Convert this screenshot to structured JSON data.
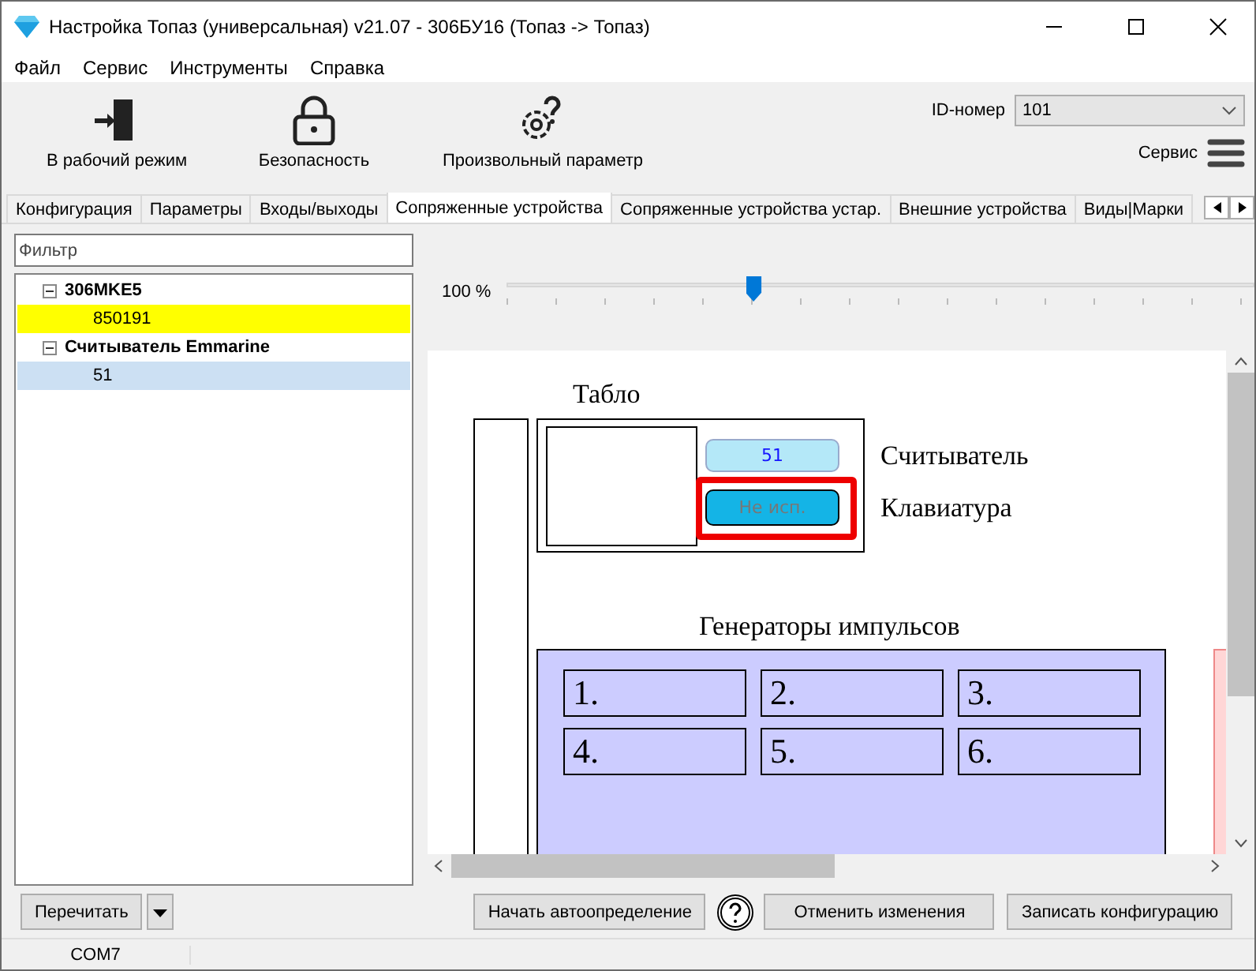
{
  "window": {
    "title": "Настройка Топаз (универсальная) v21.07 - 306БУ16 (Топаз -> Топаз)"
  },
  "menu": [
    "Файл",
    "Сервис",
    "Инструменты",
    "Справка"
  ],
  "toolbar": {
    "tools": [
      {
        "label": "В рабочий режим",
        "kind": "exit"
      },
      {
        "label": "Безопасность",
        "kind": "lock"
      },
      {
        "label": "Произвольный параметр",
        "kind": "gear"
      }
    ],
    "id_label": "ID-номер",
    "id_value": "101",
    "service_label": "Сервис"
  },
  "tabs": [
    {
      "label": "Конфигурация",
      "selected": false
    },
    {
      "label": "Параметры",
      "selected": false
    },
    {
      "label": "Входы/выходы",
      "selected": false
    },
    {
      "label": "Сопряженные устройства",
      "selected": true
    },
    {
      "label": "Сопряженные устройства устар.",
      "selected": false
    },
    {
      "label": "Внешние устройства",
      "selected": false
    },
    {
      "label": "Виды|Марки",
      "selected": false
    }
  ],
  "filter": {
    "placeholder": "Фильтр"
  },
  "tree": [
    {
      "label": "306MKE5",
      "expanded": true,
      "children": [
        {
          "label": "850191",
          "highlighted": true,
          "selected": false
        }
      ]
    },
    {
      "label": "Считыватель Emmarine",
      "expanded": true,
      "children": [
        {
          "label": "51",
          "highlighted": false,
          "selected": true
        }
      ]
    }
  ],
  "zoom": {
    "label": "100 %",
    "level": 0.33
  },
  "diagram": {
    "display_title": "Табло",
    "reader": {
      "label": "Считыватель",
      "value": "51"
    },
    "keypad": {
      "label": "Клавиатура",
      "value": "Не исп.",
      "selected": true
    },
    "generators": {
      "title": "Генераторы импульсов",
      "cells": [
        "1.",
        "2.",
        "3.",
        "4.",
        "5.",
        "6."
      ]
    }
  },
  "buttons": {
    "reread": "Перечитать",
    "autodetect": "Начать автоопределение",
    "cancel": "Отменить изменения",
    "write": "Записать конфигурацию"
  },
  "status_bar": {
    "port": "COM7"
  }
}
